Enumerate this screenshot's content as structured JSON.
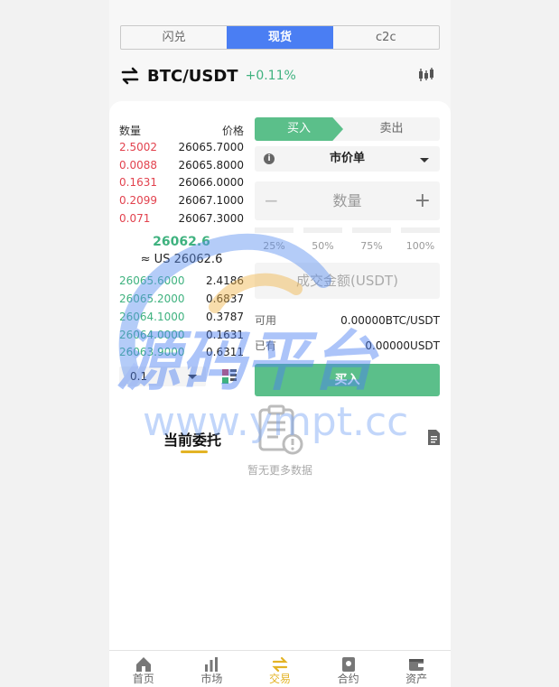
{
  "tabs": [
    {
      "label": "闪兑",
      "active": false
    },
    {
      "label": "现货",
      "active": true
    },
    {
      "label": "c2c",
      "active": false
    }
  ],
  "pair": {
    "name": "BTC/USDT",
    "change": "+0.11%"
  },
  "orderbook": {
    "header": {
      "qty": "数量",
      "price": "价格"
    },
    "asks": [
      {
        "amount": "2.5002",
        "price": "26065.7000"
      },
      {
        "amount": "0.0088",
        "price": "26065.8000"
      },
      {
        "amount": "0.1631",
        "price": "26066.0000"
      },
      {
        "amount": "0.2099",
        "price": "26067.1000"
      },
      {
        "amount": "0.071",
        "price": "26067.3000"
      }
    ],
    "last_price": "26062.6",
    "last_usd": "≈ US 26062.6",
    "bids": [
      {
        "price": "26065.6000",
        "amount": "2.4186"
      },
      {
        "price": "26065.2000",
        "amount": "0.6837"
      },
      {
        "price": "26064.1000",
        "amount": "0.3787"
      },
      {
        "price": "26064.0000",
        "amount": "0.1631"
      },
      {
        "price": "26063.9000",
        "amount": "0.6311"
      }
    ],
    "depth": "0.1"
  },
  "form": {
    "buy_tab": "买入",
    "sell_tab": "卖出",
    "order_type": "市价单",
    "qty_placeholder": "数量",
    "minus": "−",
    "plus": "+",
    "percents": [
      "25%",
      "50%",
      "75%",
      "100%"
    ],
    "amount_placeholder": "成交金额(USDT)",
    "available_label": "可用",
    "available_value": "0.00000BTC/USDT",
    "held_label": "已有",
    "held_value": "0.00000USDT",
    "submit": "买入"
  },
  "orders": {
    "title": "当前委托",
    "empty": "暂无更多数据"
  },
  "nav": [
    {
      "label": "首页",
      "icon": "home-icon",
      "active": false
    },
    {
      "label": "市场",
      "icon": "market-icon",
      "active": false
    },
    {
      "label": "交易",
      "icon": "trade-icon",
      "active": true
    },
    {
      "label": "合约",
      "icon": "contract-icon",
      "active": false
    },
    {
      "label": "资产",
      "icon": "wallet-icon",
      "active": false
    }
  ],
  "watermark": {
    "logo": "源码平台",
    "url": "www.ympt.cc"
  },
  "colors": {
    "accent": "#4a7ef3",
    "up": "#3fb27f",
    "down": "#e2424e",
    "buy": "#5bbf8a",
    "highlight": "#e3b325"
  }
}
